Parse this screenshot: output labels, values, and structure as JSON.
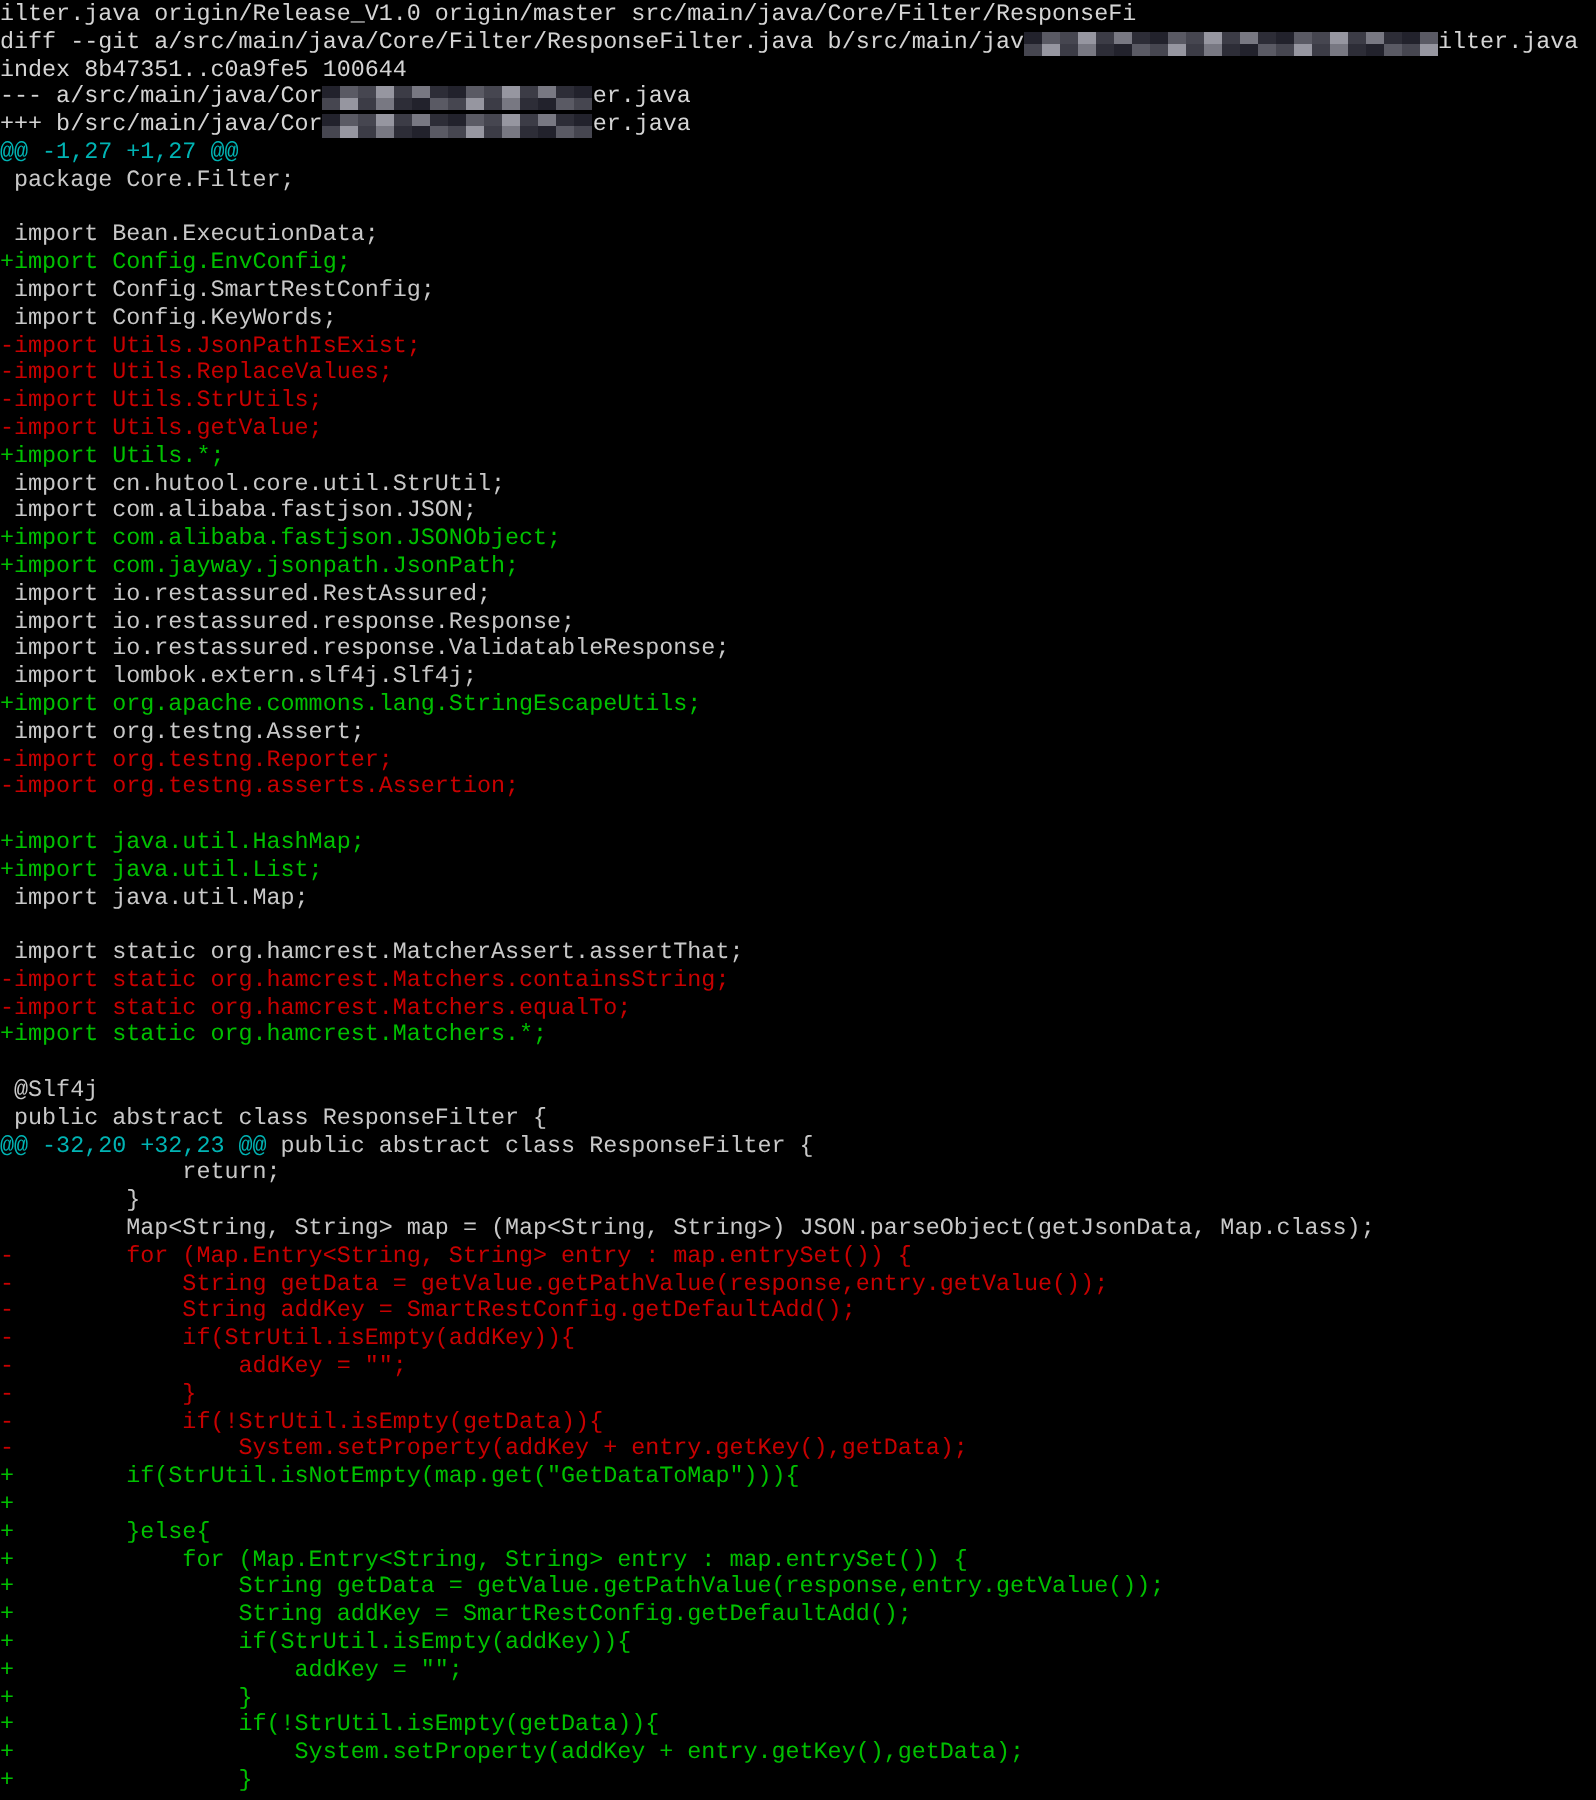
{
  "terminal": {
    "lines": [
      {
        "kind": "meta",
        "text": "ilter.java origin/Release_V1.0 origin/master src/main/java/Core/Filter/ResponseFi"
      },
      {
        "kind": "meta",
        "parts": [
          "diff --git a/src/main/java/Core/Filter/ResponseFilter.java b/src/main/jav",
          "ilter.java"
        ]
      },
      {
        "kind": "meta",
        "text": "index 8b47351..c0a9fe5 100644"
      },
      {
        "kind": "meta",
        "parts": [
          "--- a/src/main/java/Cor",
          "er.java"
        ]
      },
      {
        "kind": "meta",
        "parts": [
          "+++ b/src/main/java/Cor",
          "er.java"
        ]
      },
      {
        "kind": "hunk",
        "text": "@@ -1,27 +1,27 @@"
      },
      {
        "kind": "context",
        "text": " package Core.Filter;"
      },
      {
        "kind": "blank"
      },
      {
        "kind": "context",
        "text": " import Bean.ExecutionData;"
      },
      {
        "kind": "add",
        "text": "+import Config.EnvConfig;"
      },
      {
        "kind": "context",
        "text": " import Config.SmartRestConfig;"
      },
      {
        "kind": "context",
        "text": " import Config.KeyWords;"
      },
      {
        "kind": "del",
        "text": "-import Utils.JsonPathIsExist;"
      },
      {
        "kind": "del",
        "text": "-import Utils.ReplaceValues;"
      },
      {
        "kind": "del",
        "text": "-import Utils.StrUtils;"
      },
      {
        "kind": "del",
        "text": "-import Utils.getValue;"
      },
      {
        "kind": "add",
        "text": "+import Utils.*;"
      },
      {
        "kind": "context",
        "text": " import cn.hutool.core.util.StrUtil;"
      },
      {
        "kind": "context",
        "text": " import com.alibaba.fastjson.JSON;"
      },
      {
        "kind": "add",
        "text": "+import com.alibaba.fastjson.JSONObject;"
      },
      {
        "kind": "add",
        "text": "+import com.jayway.jsonpath.JsonPath;"
      },
      {
        "kind": "context",
        "text": " import io.restassured.RestAssured;"
      },
      {
        "kind": "context",
        "text": " import io.restassured.response.Response;"
      },
      {
        "kind": "context",
        "text": " import io.restassured.response.ValidatableResponse;"
      },
      {
        "kind": "context",
        "text": " import lombok.extern.slf4j.Slf4j;"
      },
      {
        "kind": "add",
        "text": "+import org.apache.commons.lang.StringEscapeUtils;"
      },
      {
        "kind": "context",
        "text": " import org.testng.Assert;"
      },
      {
        "kind": "del",
        "text": "-import org.testng.Reporter;"
      },
      {
        "kind": "del",
        "text": "-import org.testng.asserts.Assertion;"
      },
      {
        "kind": "blank"
      },
      {
        "kind": "add",
        "text": "+import java.util.HashMap;"
      },
      {
        "kind": "add",
        "text": "+import java.util.List;"
      },
      {
        "kind": "context",
        "text": " import java.util.Map;"
      },
      {
        "kind": "blank"
      },
      {
        "kind": "context",
        "text": " import static org.hamcrest.MatcherAssert.assertThat;"
      },
      {
        "kind": "del",
        "text": "-import static org.hamcrest.Matchers.containsString;"
      },
      {
        "kind": "del",
        "text": "-import static org.hamcrest.Matchers.equalTo;"
      },
      {
        "kind": "add",
        "text": "+import static org.hamcrest.Matchers.*;"
      },
      {
        "kind": "blank"
      },
      {
        "kind": "context",
        "text": " @Slf4j"
      },
      {
        "kind": "context",
        "text": " public abstract class ResponseFilter {"
      },
      {
        "kind": "hunk",
        "text": "@@ -32,20 +32,23 @@",
        "tail": " public abstract class ResponseFilter {"
      },
      {
        "kind": "context",
        "text": "             return;"
      },
      {
        "kind": "context",
        "text": "         }"
      },
      {
        "kind": "context",
        "text": "         Map<String, String> map = (Map<String, String>) JSON.parseObject(getJsonData, Map.class);"
      },
      {
        "kind": "del",
        "text": "-        for (Map.Entry<String, String> entry : map.entrySet()) {"
      },
      {
        "kind": "del",
        "text": "-            String getData = getValue.getPathValue(response,entry.getValue());"
      },
      {
        "kind": "del",
        "text": "-            String addKey = SmartRestConfig.getDefaultAdd();"
      },
      {
        "kind": "del",
        "text": "-            if(StrUtil.isEmpty(addKey)){"
      },
      {
        "kind": "del",
        "text": "-                addKey = \"\";"
      },
      {
        "kind": "del",
        "text": "-            }"
      },
      {
        "kind": "del",
        "text": "-            if(!StrUtil.isEmpty(getData)){"
      },
      {
        "kind": "del",
        "text": "-                System.setProperty(addKey + entry.getKey(),getData);"
      },
      {
        "kind": "add",
        "text": "+        if(StrUtil.isNotEmpty(map.get(\"GetDataToMap\"))){"
      },
      {
        "kind": "add",
        "text": "+"
      },
      {
        "kind": "add",
        "text": "+        }else{"
      },
      {
        "kind": "add",
        "text": "+            for (Map.Entry<String, String> entry : map.entrySet()) {"
      },
      {
        "kind": "add",
        "text": "+                String getData = getValue.getPathValue(response,entry.getValue());"
      },
      {
        "kind": "add",
        "text": "+                String addKey = SmartRestConfig.getDefaultAdd();"
      },
      {
        "kind": "add",
        "text": "+                if(StrUtil.isEmpty(addKey)){"
      },
      {
        "kind": "add",
        "text": "+                    addKey = \"\";"
      },
      {
        "kind": "add",
        "text": "+                }"
      },
      {
        "kind": "add",
        "text": "+                if(!StrUtil.isEmpty(getData)){"
      },
      {
        "kind": "add",
        "text": "+                    System.setProperty(addKey + entry.getKey(),getData);"
      },
      {
        "kind": "add",
        "text": "+                }"
      }
    ]
  }
}
